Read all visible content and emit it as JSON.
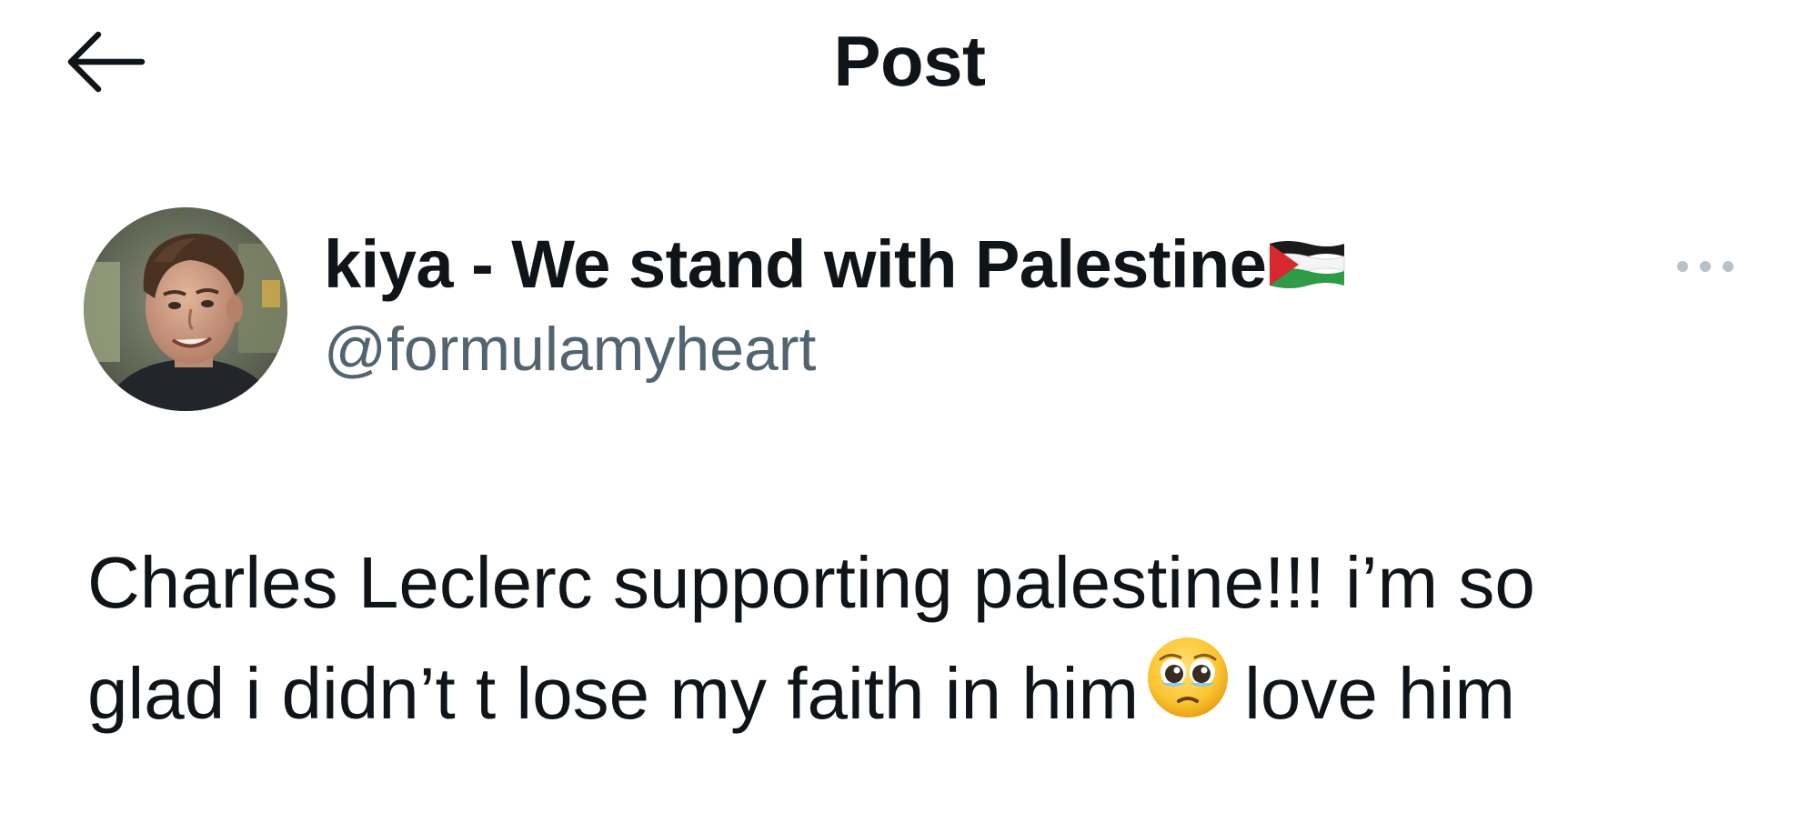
{
  "header": {
    "title": "Post",
    "back_icon": "arrow-left-icon"
  },
  "author": {
    "display_name": "kiya - We stand with Palestine",
    "display_name_emoji": "palestine-flag-icon",
    "handle": "@formulamyheart",
    "avatar_icon": "avatar-photo"
  },
  "more_icon": "more-horizontal-icon",
  "tweet": {
    "line1": "Charles Leclerc supporting palestine!!! i’m so",
    "line2_before_emoji": "glad i didn’t t lose my faith in him",
    "emoji": "pleading-face-emoji-icon",
    "line2_after_emoji": "love him"
  },
  "colors": {
    "text_primary": "#0f1419",
    "text_secondary": "#536471",
    "background": "#ffffff"
  }
}
